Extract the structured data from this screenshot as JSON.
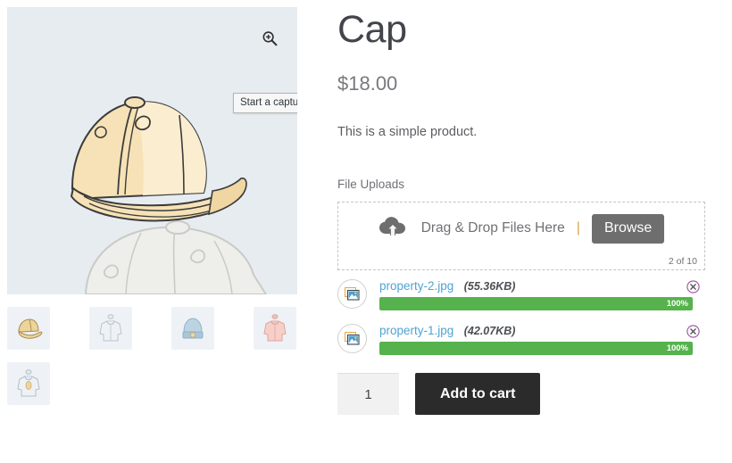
{
  "gallery": {
    "zoom_icon": "magnifier-plus-icon",
    "tooltip": "Start a capture",
    "main_image_alt": "cap",
    "thumbnails": [
      {
        "name": "cap",
        "selected": true
      },
      {
        "name": "hoodie-grey",
        "selected": false
      },
      {
        "name": "beanie",
        "selected": false
      },
      {
        "name": "hoodie-pink",
        "selected": false
      },
      {
        "name": "hoodie-with-logo",
        "selected": false
      }
    ]
  },
  "product": {
    "title": "Cap",
    "price": "$18.00",
    "description": "This is a simple product."
  },
  "uploads": {
    "section_label": "File Uploads",
    "drop_text": "Drag & Drop Files Here",
    "separator": "|",
    "browse_label": "Browse",
    "counter": "2 of 10",
    "cloud_icon": "cloud-upload-icon",
    "files": [
      {
        "name": "property-2.jpg",
        "size": "(55.36KB)",
        "progress": "100%",
        "progress_value": 100,
        "icon": "image-file-icon",
        "remove_icon": "remove-circle-icon"
      },
      {
        "name": "property-1.jpg",
        "size": "(42.07KB)",
        "progress": "100%",
        "progress_value": 100,
        "icon": "image-file-icon",
        "remove_icon": "remove-circle-icon"
      }
    ]
  },
  "cart": {
    "quantity": "1",
    "quantity_placeholder": "1",
    "add_to_cart_label": "Add to cart"
  },
  "colors": {
    "image_bg": "#e7ecf1",
    "progress_green": "#55b24c",
    "browse_grey": "#6e6e6e",
    "cart_black": "#2b2b2b",
    "link_blue": "#4fa3d1",
    "remove_purple": "#9a4fa0"
  }
}
